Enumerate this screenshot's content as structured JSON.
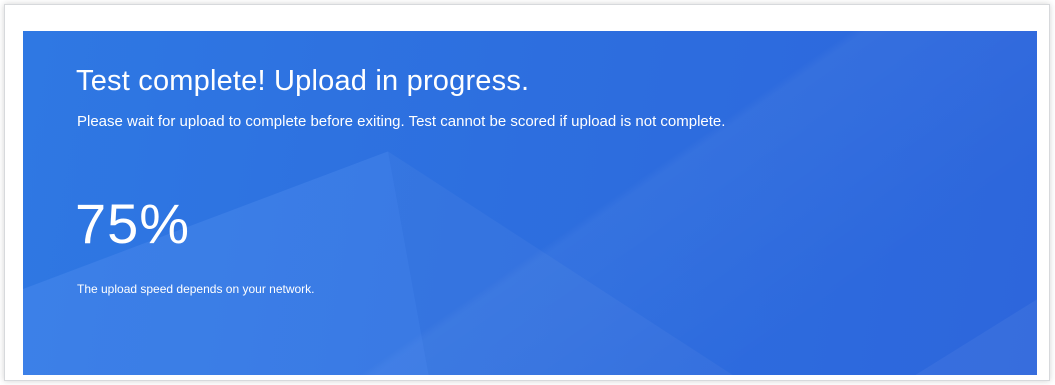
{
  "status": {
    "title": "Test complete! Upload in progress.",
    "subtitle": "Please wait for upload to complete before exiting. Test cannot be scored if upload is not complete.",
    "progress_text": "75%",
    "progress_fraction": 0.75,
    "note": "The upload speed depends on your network."
  },
  "colors": {
    "banner_primary": "#2d6fdf",
    "text": "#ffffff"
  }
}
